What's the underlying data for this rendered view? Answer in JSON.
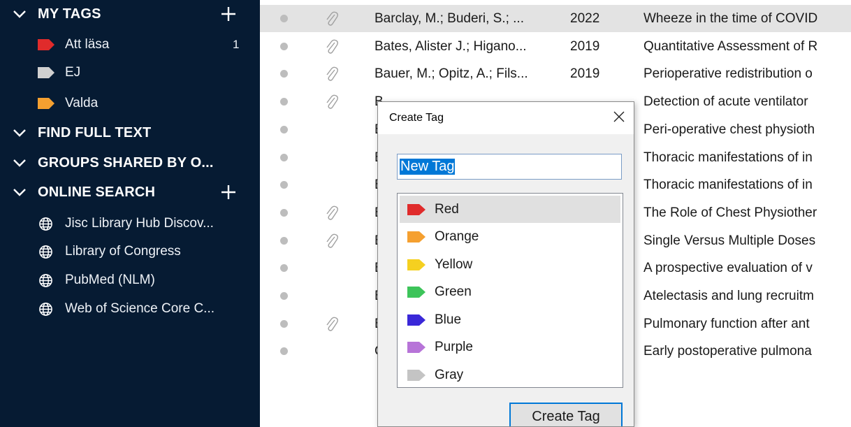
{
  "sidebar": {
    "my_tags": {
      "label": "MY TAGS",
      "tags": [
        {
          "label": "Att läsa",
          "color": "#e02b2b",
          "count": "1"
        },
        {
          "label": "EJ",
          "color": "#d0d0d0",
          "count": ""
        },
        {
          "label": "Valda",
          "color": "#f5a030",
          "count": ""
        }
      ]
    },
    "find_full_text": {
      "label": "FIND FULL TEXT"
    },
    "groups_shared": {
      "label": "GROUPS SHARED BY O..."
    },
    "online_search": {
      "label": "ONLINE SEARCH",
      "items": [
        {
          "label": "Jisc Library Hub Discov..."
        },
        {
          "label": "Library of Congress"
        },
        {
          "label": "PubMed (NLM)"
        },
        {
          "label": "Web of Science Core C..."
        }
      ]
    }
  },
  "items": [
    {
      "creator": "Barclay, M.; Buderi, S.; ...",
      "year": "2022",
      "title": "Wheeze in the time of COVID",
      "attachment": true,
      "selected": true
    },
    {
      "creator": "Bates, Alister J.; Higano...",
      "year": "2019",
      "title": "Quantitative Assessment of R",
      "attachment": true
    },
    {
      "creator": "Bauer, M.; Opitz, A.; Fils...",
      "year": "2019",
      "title": "Perioperative redistribution o",
      "attachment": true
    },
    {
      "creator": "B",
      "year": "",
      "title": "Detection of acute ventilator",
      "attachment": true
    },
    {
      "creator": "B",
      "year": "",
      "title": "Peri-operative chest physioth",
      "attachment": false
    },
    {
      "creator": "B",
      "year": "",
      "title": "Thoracic manifestations of in",
      "attachment": false
    },
    {
      "creator": "B",
      "year": "",
      "title": "Thoracic manifestations of in",
      "attachment": false
    },
    {
      "creator": "B",
      "year": "",
      "title": "The Role of Chest Physiother",
      "attachment": true
    },
    {
      "creator": "B",
      "year": "",
      "title": "Single Versus Multiple Doses",
      "attachment": true
    },
    {
      "creator": "B",
      "year": "",
      "title": "A prospective evaluation of v",
      "attachment": false
    },
    {
      "creator": "B",
      "year": "",
      "title": "Atelectasis and lung recruitm",
      "attachment": false
    },
    {
      "creator": "B",
      "year": "",
      "title": "Pulmonary function after ant",
      "attachment": true
    },
    {
      "creator": "C",
      "year": "",
      "title": "Early postoperative pulmona",
      "attachment": false
    }
  ],
  "dialog": {
    "title": "Create Tag",
    "name_value": "New Tag",
    "colors": [
      {
        "label": "Red",
        "color": "#e02b2b",
        "selected": true
      },
      {
        "label": "Orange",
        "color": "#f5a030"
      },
      {
        "label": "Yellow",
        "color": "#f5d020"
      },
      {
        "label": "Green",
        "color": "#3dc45a"
      },
      {
        "label": "Blue",
        "color": "#3a28d8"
      },
      {
        "label": "Purple",
        "color": "#b774d8"
      },
      {
        "label": "Gray",
        "color": "#c4c4c4"
      }
    ],
    "create_label": "Create Tag"
  }
}
